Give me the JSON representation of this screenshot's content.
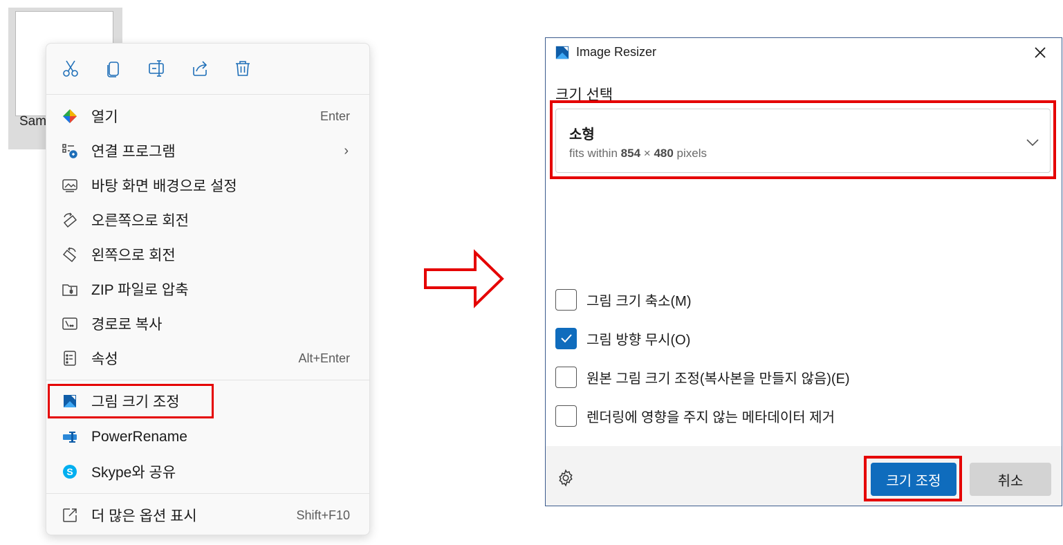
{
  "file": {
    "name": "Sam"
  },
  "toolbar": {
    "icons": [
      "cut-icon",
      "copy-icon",
      "rename-icon",
      "share-icon",
      "delete-icon"
    ]
  },
  "menu": {
    "items": [
      {
        "label": "열기",
        "shortcut": "Enter",
        "icon": "open-icon"
      },
      {
        "label": "연결 프로그램",
        "shortcut": "",
        "icon": "open-with-icon",
        "submenu": "›"
      },
      {
        "label": "바탕 화면 배경으로 설정",
        "shortcut": "",
        "icon": "wallpaper-icon"
      },
      {
        "label": "오른쪽으로 회전",
        "shortcut": "",
        "icon": "rotate-right-icon"
      },
      {
        "label": "왼쪽으로 회전",
        "shortcut": "",
        "icon": "rotate-left-icon"
      },
      {
        "label": "ZIP 파일로 압축",
        "shortcut": "",
        "icon": "zip-icon"
      },
      {
        "label": "경로로 복사",
        "shortcut": "",
        "icon": "copy-path-icon"
      },
      {
        "label": "속성",
        "shortcut": "Alt+Enter",
        "icon": "properties-icon"
      },
      {
        "label": "그림 크기 조정",
        "shortcut": "",
        "icon": "image-resizer-icon"
      },
      {
        "label": "PowerRename",
        "shortcut": "",
        "icon": "powerrename-icon"
      },
      {
        "label": "Skype와 공유",
        "shortcut": "",
        "icon": "skype-icon"
      },
      {
        "label": "더 많은 옵션 표시",
        "shortcut": "Shift+F10",
        "icon": "more-options-icon"
      }
    ]
  },
  "dialog": {
    "title": "Image Resizer",
    "size_label": "크기 선택",
    "selected_size": {
      "name": "소형",
      "desc_prefix": "fits within",
      "width": "854",
      "times": "×",
      "height": "480",
      "unit": "pixels"
    },
    "options": [
      {
        "label": "그림 크기 축소(M)",
        "checked": false
      },
      {
        "label": "그림 방향 무시(O)",
        "checked": true
      },
      {
        "label": "원본 그림 크기 조정(복사본을 만들지 않음)(E)",
        "checked": false
      },
      {
        "label": "렌더링에 영향을 주지 않는 메타데이터 제거",
        "checked": false
      }
    ],
    "resize_button": "크기 조정",
    "cancel_button": "취소"
  },
  "colors": {
    "accent": "#0f6cbd",
    "highlight": "#e50000"
  }
}
